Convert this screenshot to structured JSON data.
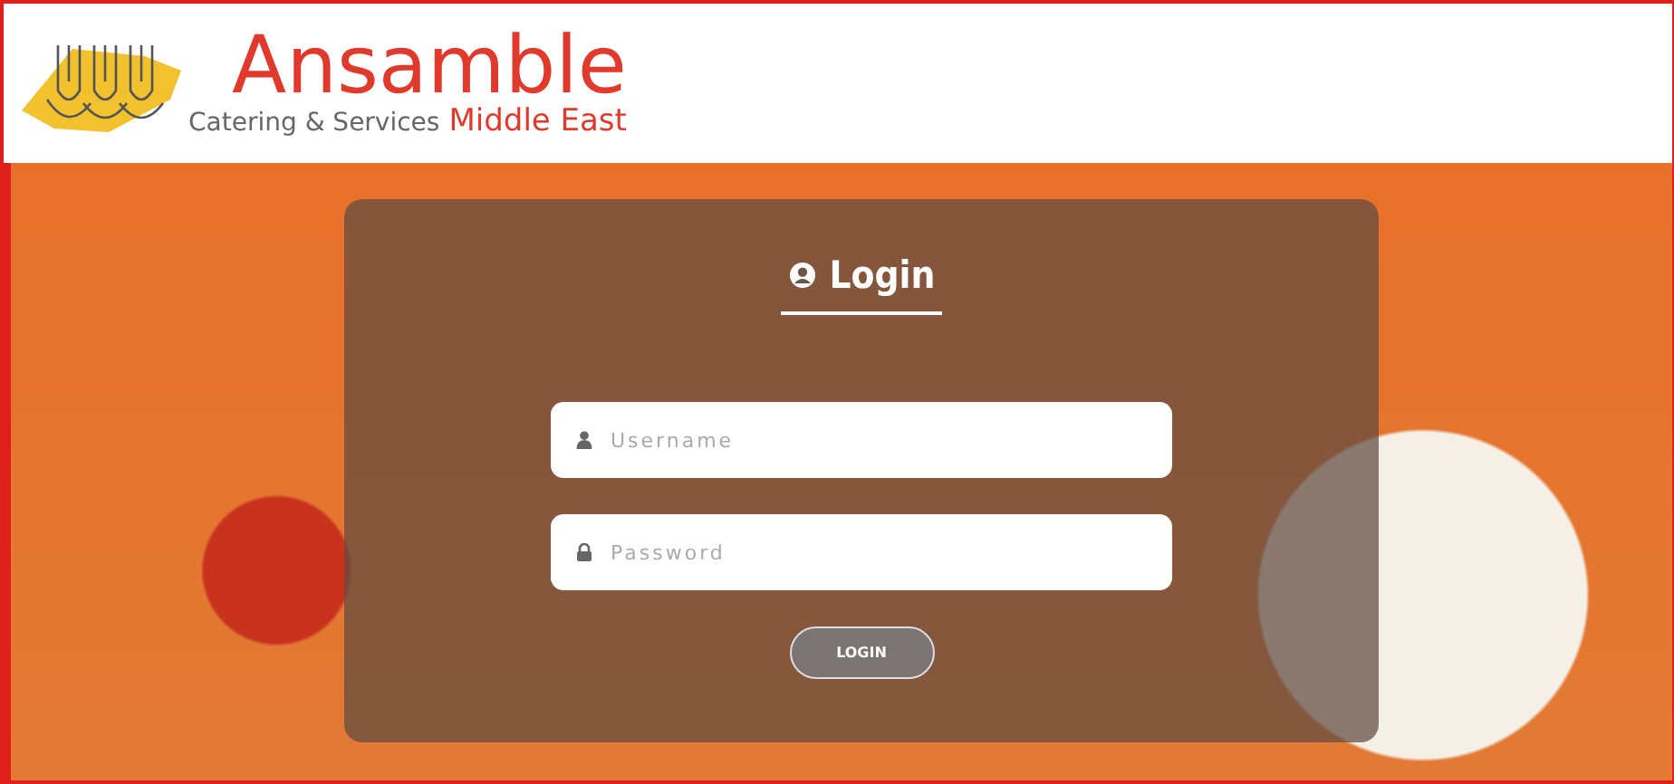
{
  "logo": {
    "name": "Ansamble",
    "tagline": "Catering & Services",
    "region": "Middle East"
  },
  "login": {
    "title": "Login",
    "fields": [
      {
        "kind": "text",
        "placeholder": "Username"
      },
      {
        "kind": "password",
        "placeholder": "Password"
      }
    ],
    "button": "LOGIN"
  }
}
